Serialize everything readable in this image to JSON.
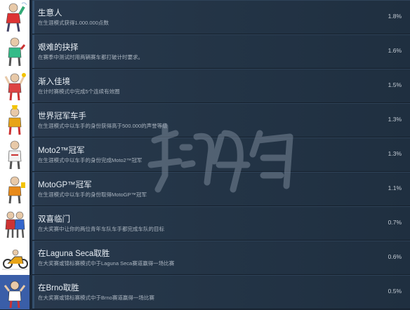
{
  "achievements": [
    {
      "title": "生意人",
      "desc": "在生涯模式获得1.000.000点数",
      "pct": "1.8%",
      "icon": "rider-champagne-icon"
    },
    {
      "title": "艰难的抉择",
      "desc": "在赛季中测试时用两辆赛车都打破计时要求。",
      "pct": "1.6%",
      "icon": "rider-thumbs-up-icon"
    },
    {
      "title": "渐入佳境",
      "desc": "在计时赛模式中完成5个连续有效圈",
      "pct": "1.5%",
      "icon": "rider-fists-up-icon"
    },
    {
      "title": "世界冠军车手",
      "desc": "在生涯模式中以车手的身份获得高于500.000的声誉等级",
      "pct": "1.3%",
      "icon": "rider-trophy-icon"
    },
    {
      "title": "Moto2™冠军",
      "desc": "在生涯模式中以车手的身份完成Moto2™冠军",
      "pct": "1.3%",
      "icon": "rider-standing-icon"
    },
    {
      "title": "MotoGP™冠军",
      "desc": "在生涯模式中以车手的身份取得MotoGP™冠军",
      "pct": "1.1%",
      "icon": "rider-cup-icon"
    },
    {
      "title": "双喜临门",
      "desc": "在大奖赛中让你的两位青年车队车手都完成车队的目标",
      "pct": "0.7%",
      "icon": "two-riders-icon"
    },
    {
      "title": "在Laguna Seca取胜",
      "desc": "在大奖赛或锦标赛模式中于Laguna Seca赛道赢得一场比赛",
      "pct": "0.6%",
      "icon": "motorbike-racing-icon"
    },
    {
      "title": "在Brno取胜",
      "desc": "在大奖赛或锦标赛模式中于Brno赛道赢得一场比赛",
      "pct": "0.5%",
      "icon": "rider-celebration-icon"
    }
  ]
}
